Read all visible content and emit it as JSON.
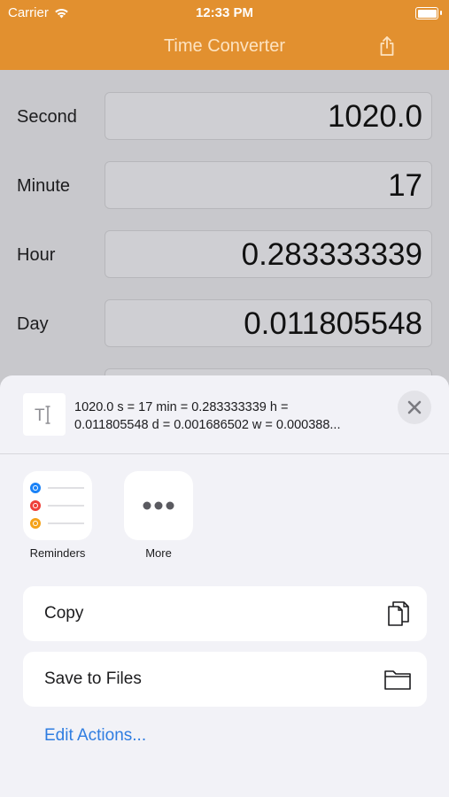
{
  "status": {
    "carrier": "Carrier",
    "time": "12:33 PM"
  },
  "nav": {
    "title": "Time Converter"
  },
  "rows": [
    {
      "label": "Second",
      "value": "1020.0"
    },
    {
      "label": "Minute",
      "value": "17"
    },
    {
      "label": "Hour",
      "value": "0.283333339"
    },
    {
      "label": "Day",
      "value": "0.011805548"
    }
  ],
  "share": {
    "preview_line1": "1020.0 s = 17 min = 0.283333339 h =",
    "preview_line2": "0.011805548 d = 0.001686502 w = 0.000388...",
    "apps": [
      {
        "label": "Reminders",
        "icon": "reminders-icon"
      },
      {
        "label": "More",
        "icon": "more-icon"
      }
    ],
    "actions": [
      {
        "label": "Copy",
        "icon": "copy-icon"
      },
      {
        "label": "Save to Files",
        "icon": "folder-icon"
      }
    ],
    "edit_actions": "Edit Actions..."
  },
  "colors": {
    "nav_bar": "#e2902f",
    "link": "#2f7de1",
    "reminder_blue": "#1a82f7",
    "reminder_red": "#ee4038",
    "reminder_orange": "#f4a21a"
  }
}
